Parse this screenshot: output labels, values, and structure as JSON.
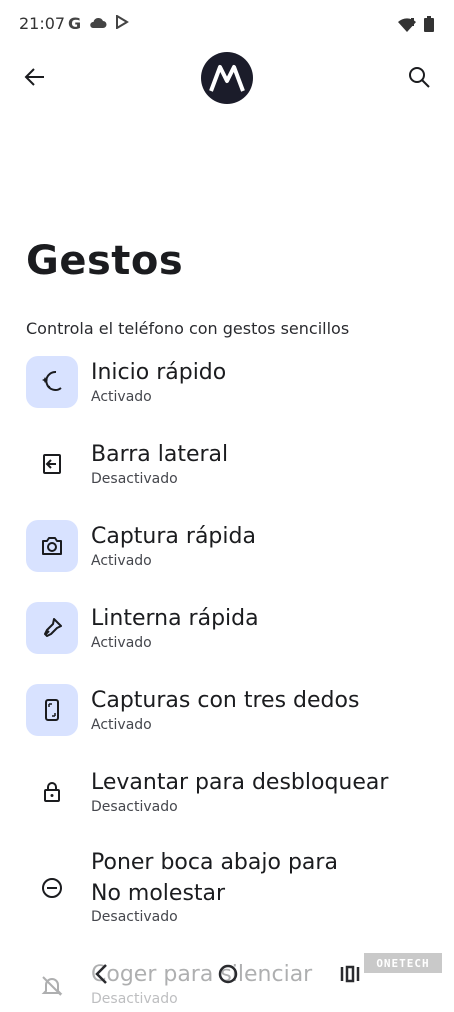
{
  "status_bar": {
    "time": "21:07",
    "carrier_glyph": "G"
  },
  "page": {
    "title": "Gestos",
    "subtitle": "Controla el teléfono con gestos sencillos"
  },
  "items": [
    {
      "title": "Inicio rápido",
      "status": "Activado",
      "active": true,
      "icon": "sparkle-moon-icon"
    },
    {
      "title": "Barra lateral",
      "status": "Desactivado",
      "active": false,
      "icon": "side-bar-icon"
    },
    {
      "title": "Captura rápida",
      "status": "Activado",
      "active": true,
      "icon": "camera-icon"
    },
    {
      "title": "Linterna rápida",
      "status": "Activado",
      "active": true,
      "icon": "flashlight-icon"
    },
    {
      "title": "Capturas con tres dedos",
      "status": "Activado",
      "active": true,
      "icon": "phone-screenshot-icon"
    },
    {
      "title": "Levantar para desbloquear",
      "status": "Desactivado",
      "active": false,
      "icon": "lock-icon"
    },
    {
      "title_line1": "Poner boca abajo para",
      "title_line2": "No molestar",
      "status": "Desactivado",
      "active": false,
      "icon": "do-not-disturb-icon"
    },
    {
      "title": "Coger para silenciar",
      "status": "Desactivado",
      "active": false,
      "icon": "bell-off-icon"
    }
  ],
  "watermark": "ONETECH",
  "colors": {
    "active_icon_bg": "#d8e2ff",
    "logo_bg": "#1b1c2a",
    "text": "#1b1c1f"
  }
}
